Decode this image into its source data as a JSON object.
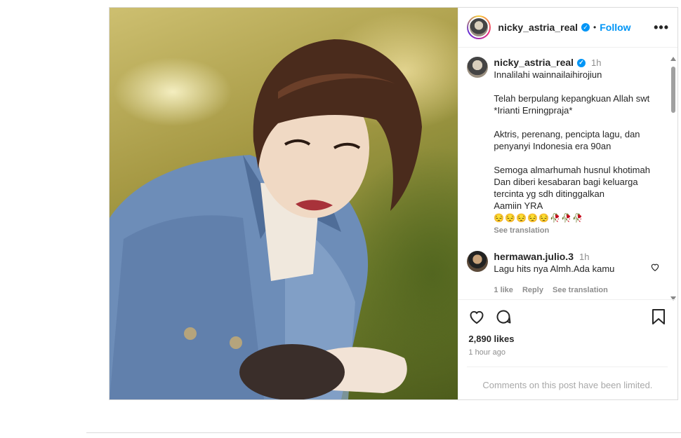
{
  "post": {
    "username": "nicky_astria_real",
    "follow_label": "Follow",
    "more_label": "•••",
    "caption": {
      "username": "nicky_astria_real",
      "time": "1h",
      "paragraphs": [
        "Innalilahi wainnailaihirojiun",
        "Telah berpulang kepangkuan Allah swt\n*Irianti Erningpraja*",
        "Aktris, perenang, pencipta lagu, dan\npenyanyi Indonesia era 90an",
        "Semoga almarhumah husnul khotimah\nDan diberi kesabaran bagi keluarga\ntercinta yg sdh ditinggalkan\nAamiin YRA"
      ],
      "emojis": "😔😔😔😔😔🥀🥀🥀",
      "see_translation": "See translation"
    },
    "comment": {
      "username": "hermawan.julio.3",
      "time": "1h",
      "text": "Lagu hits nya Almh.Ada kamu",
      "likes": "1 like",
      "reply": "Reply",
      "see_translation": "See translation"
    },
    "likes_count": "2,890 likes",
    "posted_ago": "1 hour ago",
    "comments_limited": "Comments on this post have been limited."
  }
}
